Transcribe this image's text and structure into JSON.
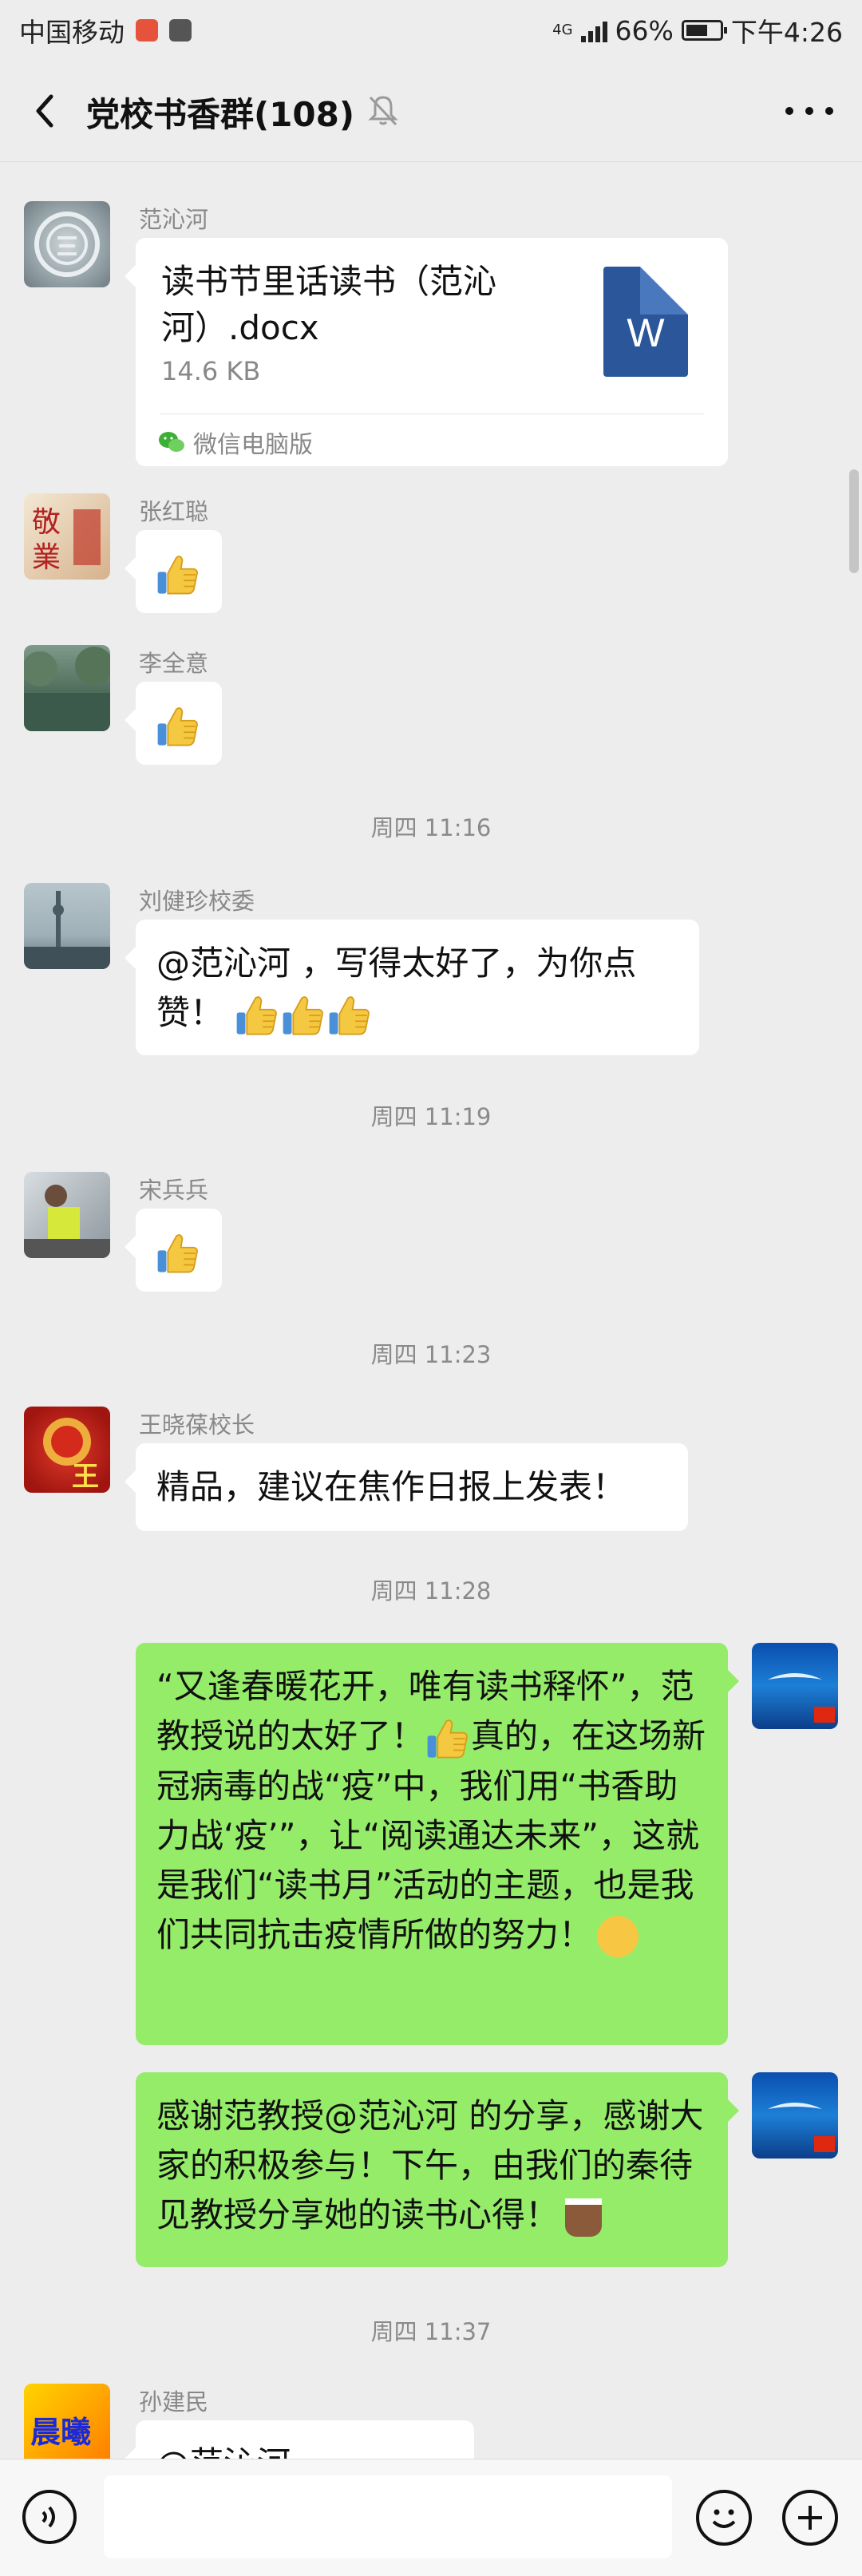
{
  "status_bar": {
    "carrier": "中国移动",
    "network": "4G",
    "battery": "66%",
    "time": "下午4:26"
  },
  "header": {
    "title": "党校书香群(108)"
  },
  "messages": [
    {
      "sender": "范沁河",
      "type": "file",
      "file_name": "读书节里话读书（范沁河）.docx",
      "file_size": "14.6 KB",
      "file_icon": "W",
      "source": "微信电脑版"
    },
    {
      "sender": "张红聪",
      "type": "emoji"
    },
    {
      "sender": "李全意",
      "type": "emoji"
    },
    {
      "timestamp": "周四 11:16"
    },
    {
      "sender": "刘健珍校委",
      "type": "text",
      "text": "@范沁河 ，写得太好了，为你点赞！"
    },
    {
      "timestamp": "周四 11:19"
    },
    {
      "sender": "宋兵兵",
      "type": "emoji"
    },
    {
      "timestamp": "周四 11:23"
    },
    {
      "sender": "王晓葆校长",
      "type": "text",
      "text": "精品，建议在焦作日报上发表！",
      "avatar_text": "王"
    },
    {
      "timestamp": "周四 11:28"
    },
    {
      "type": "self",
      "text_1": "“又逢春暖花开，唯有读书释怀”，范教授说的太好了！",
      "text_2": "真的，在这场新冠病毒的战“疫”中，我们用“书香助力战‘疫’”，让“阅读通达未来”，这就是我们“读书月”活动的主题，也是我们共同抗击疫情所做的努力！"
    },
    {
      "type": "self",
      "text": "感谢范教授@范沁河  的分享，感谢大家的积极参与！下午，由我们的秦待见教授分享她的读书心得！"
    },
    {
      "timestamp": "周四 11:37"
    },
    {
      "sender": "孙建民",
      "type": "text",
      "text": "@范沁河",
      "avatar_text": "晨曦"
    }
  ],
  "icons": {
    "back": "chevron-left-icon",
    "mute": "bell-off-icon",
    "more": "more-dots-icon",
    "voice": "voice-icon",
    "emoji": "emoji-icon",
    "plus": "plus-icon"
  },
  "colors": {
    "background": "#ededed",
    "self_bubble": "#95ec69",
    "other_bubble": "#ffffff",
    "word_icon": "#2b579a"
  }
}
